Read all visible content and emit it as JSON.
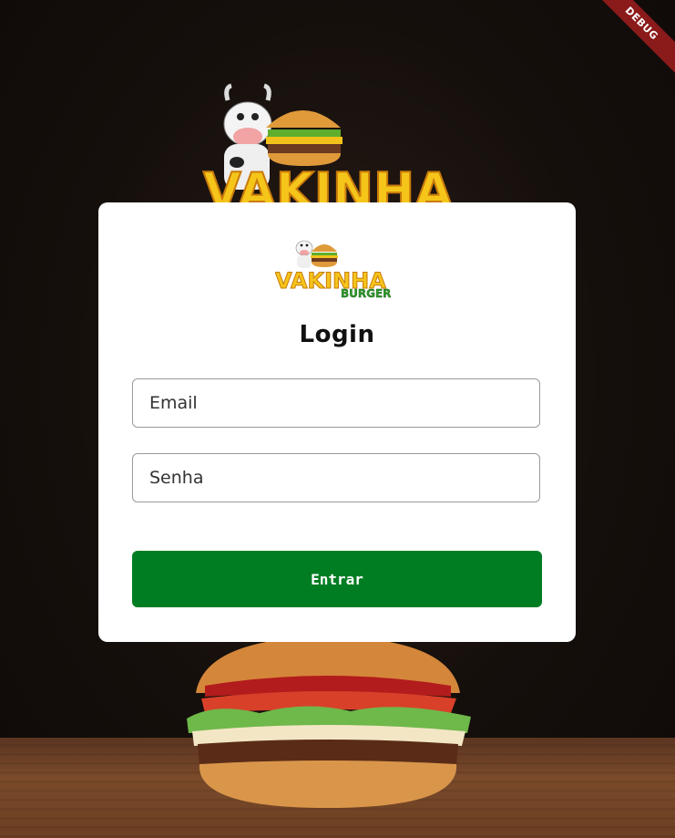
{
  "debug_banner": "DEBUG",
  "login": {
    "title": "Login",
    "email_placeholder": "Email",
    "password_placeholder": "Senha",
    "submit_label": "Entrar"
  },
  "logo": {
    "brand_text": "VAKINHA",
    "sub_text": "BURGER"
  },
  "colors": {
    "accent": "#007d22",
    "logo_yellow": "#f5c51a",
    "logo_green": "#2e9a2a",
    "background": "#140e0c"
  }
}
